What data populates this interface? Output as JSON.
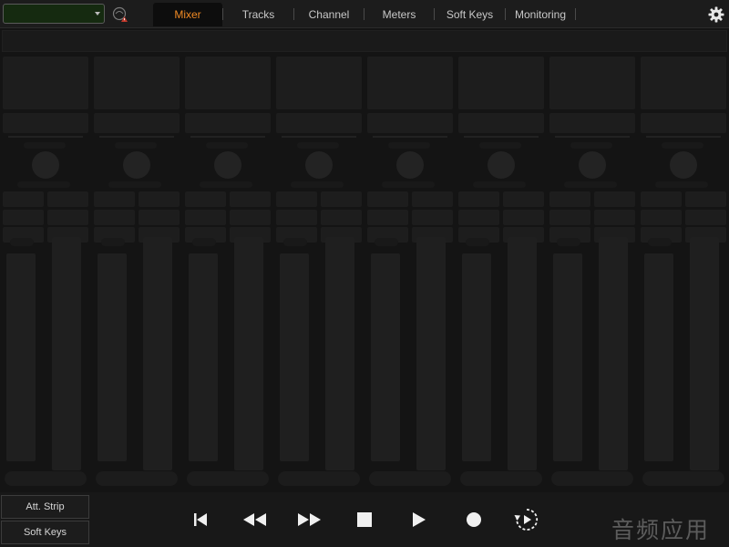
{
  "topbar": {
    "session_select": {
      "value": "",
      "icon": "dropdown-caret"
    },
    "connection_icon": "connection-status-icon",
    "tabs": [
      {
        "label": "Mixer",
        "active": true
      },
      {
        "label": "Tracks",
        "active": false
      },
      {
        "label": "Channel",
        "active": false
      },
      {
        "label": "Meters",
        "active": false
      },
      {
        "label": "Soft Keys",
        "active": false
      },
      {
        "label": "Monitoring",
        "active": false
      }
    ],
    "settings_icon": "gear-icon"
  },
  "mixer": {
    "strip_count": 8
  },
  "bottombar": {
    "att_strip_label": "Att. Strip",
    "soft_keys_label": "Soft Keys",
    "transport": [
      "return-to-zero-icon",
      "rewind-icon",
      "fast-forward-icon",
      "stop-icon",
      "play-icon",
      "record-icon",
      "loop-playback-icon"
    ]
  },
  "watermark": "音频应用",
  "colors": {
    "background": "#141414",
    "active_tab_text": "#f08a24",
    "session_select_bg": "#152a10",
    "strip_block": "#1d1d1d"
  }
}
